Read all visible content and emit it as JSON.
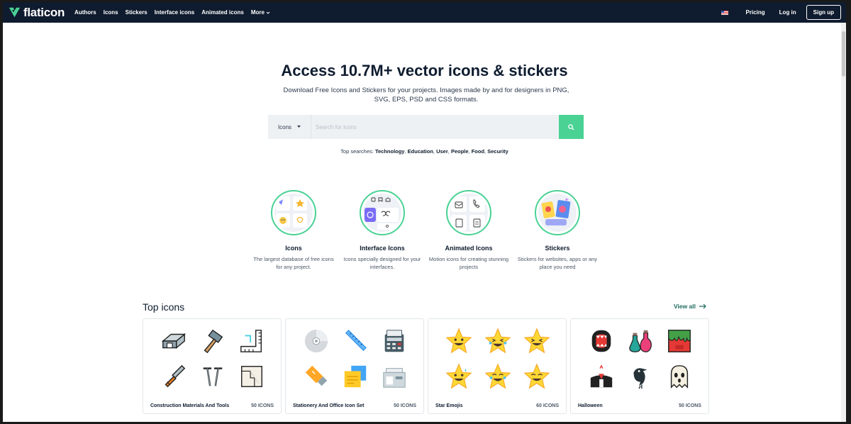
{
  "nav": {
    "brand": "flaticon",
    "links": [
      "Authors",
      "Icons",
      "Stickers",
      "Interface icons",
      "Animated icons",
      "More"
    ],
    "pricing": "Pricing",
    "login": "Log in",
    "signup": "Sign up"
  },
  "hero": {
    "title": "Access 10.7M+ vector icons & stickers",
    "subtitle": "Download Free Icons and Stickers for your projects. Images made by and for designers in PNG, SVG, EPS, PSD and CSS formats."
  },
  "search": {
    "type": "Icons",
    "placeholder": "Search for icons",
    "top_label": "Top searches:",
    "top_terms": [
      "Technology",
      "Education",
      "User",
      "People",
      "Food",
      "Security"
    ]
  },
  "categories": [
    {
      "title": "Icons",
      "desc": "The largest database of free icons for any project."
    },
    {
      "title": "Interface Icons",
      "desc": "Icons specially designed for your interfaces."
    },
    {
      "title": "Animated Icons",
      "desc": "Motion icons for creating stunning projects"
    },
    {
      "title": "Stickers",
      "desc": "Stickers for websites, apps or any place you need"
    }
  ],
  "top_icons": {
    "title": "Top icons",
    "view_all": "View all",
    "packs": [
      {
        "name": "Construction Materials And Tools",
        "count": "50 ICONS"
      },
      {
        "name": "Stationery And Office Icon Set",
        "count": "50 ICONS"
      },
      {
        "name": "Star Emojis",
        "count": "60 ICONS"
      },
      {
        "name": "Halloween",
        "count": "50 ICONS"
      }
    ]
  },
  "colors": {
    "nav_bg": "#0f1b2e",
    "accent": "#4ad295",
    "link_green": "#1d6b5e"
  }
}
